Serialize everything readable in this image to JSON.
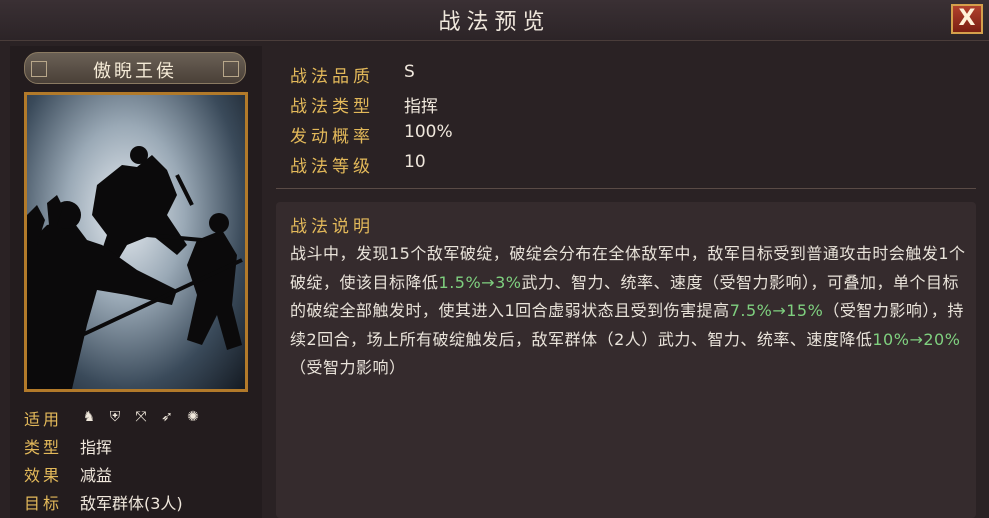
{
  "header": {
    "title": "战法预览",
    "close_label": "X"
  },
  "hero": {
    "name": "傲睨王侯"
  },
  "attributes": [
    {
      "label": "适用",
      "value": ""
    },
    {
      "label": "类型",
      "value": "指挥"
    },
    {
      "label": "效果",
      "value": "减益"
    },
    {
      "label": "目标",
      "value": "敌军群体(3人)"
    }
  ],
  "applicable_icons": [
    "cavalry-icon",
    "shield-icon",
    "bow-icon",
    "spear-icon",
    "siege-icon"
  ],
  "info": [
    {
      "label": "战法品质",
      "value": "S"
    },
    {
      "label": "战法类型",
      "value": "指挥"
    },
    {
      "label": "发动概率",
      "value": "100%"
    },
    {
      "label": "战法等级",
      "value": "10"
    }
  ],
  "description": {
    "title": "战法说明",
    "seg1": "战斗中，发现15个敌军破绽，破绽会分布在全体敌军中，敌军目标受到普通攻击时会触发1个破绽，使该目标降低",
    "hl1": "1.5%→3%",
    "seg2": "武力、智力、统率、速度（受智力影响），可叠加，单个目标的破绽全部触发时，使其进入1回合虚弱状态且受到伤害提高",
    "hl2": "7.5%→15%",
    "seg3": "（受智力影响），持续2回合，场上所有破绽触发后，敌军群体（2人）武力、智力、统率、速度降低",
    "hl3": "10%→20%",
    "seg4": "（受智力影响）"
  },
  "colors": {
    "accent": "#e3b95a",
    "highlight": "#7fd07f",
    "background": "#2a2224"
  }
}
